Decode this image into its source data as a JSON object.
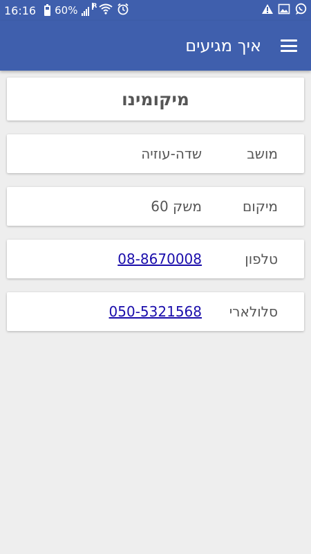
{
  "status_bar": {
    "time": "16:16",
    "battery_percent": "60%",
    "battery_level": 0.6,
    "signal_indicator": "R",
    "icons": [
      "battery-icon",
      "signal-icon",
      "wifi-icon",
      "alarm-icon",
      "warning-icon",
      "image-icon",
      "whatsapp-icon"
    ]
  },
  "header": {
    "title": "איך מגיעים",
    "menu_icon": "menu-icon"
  },
  "card": {
    "title": "מיקומינו"
  },
  "rows": [
    {
      "label": "מושב",
      "value": "שדה-עוזיה",
      "is_link": false
    },
    {
      "label": "מיקום",
      "value": "משק 60",
      "is_link": false
    },
    {
      "label": "טלפון",
      "value": "08-8670008",
      "is_link": true
    },
    {
      "label": "סלולארי",
      "value": "050-5321568",
      "is_link": true
    }
  ],
  "colors": {
    "primary": "#3f5fad",
    "background": "#eeeeee",
    "link": "#1a0dab"
  }
}
